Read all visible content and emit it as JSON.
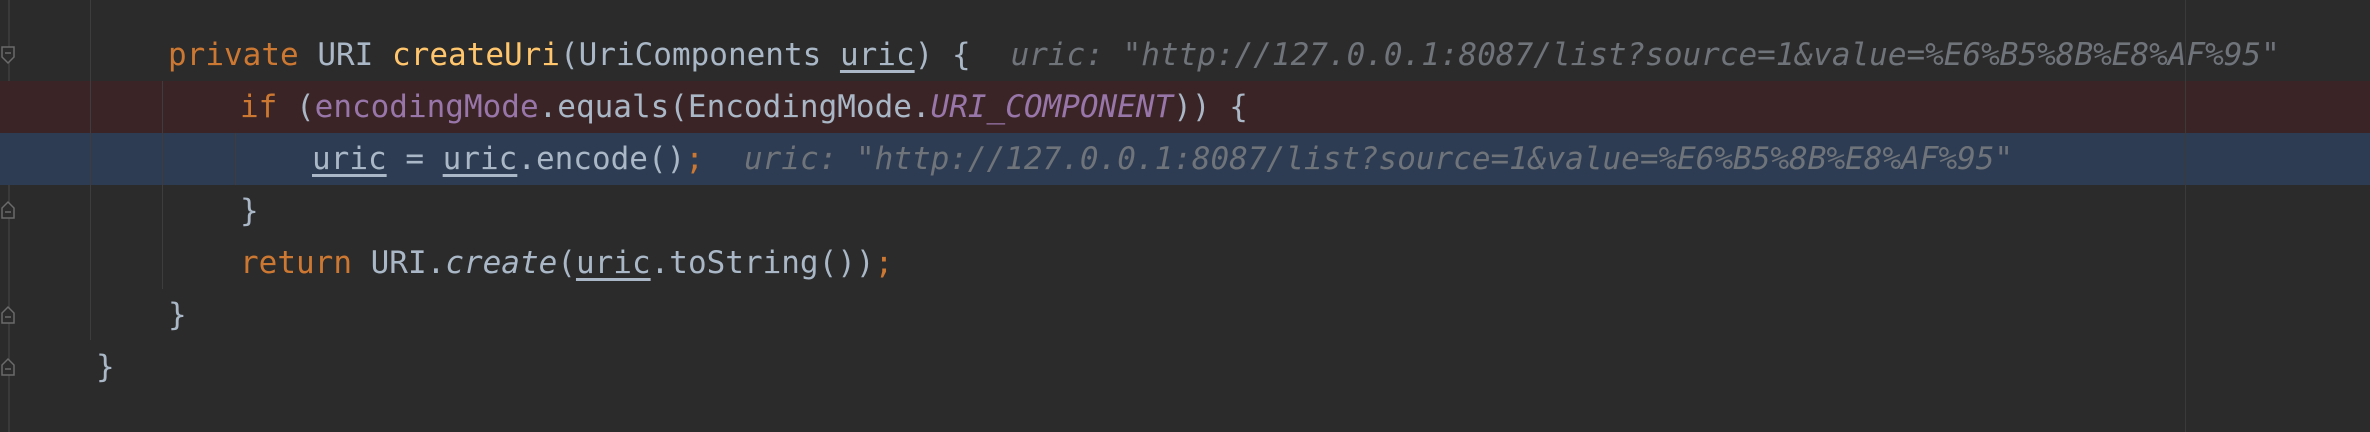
{
  "editor": {
    "lines": [
      {
        "tokens": {
          "private": "private",
          "uri_type": "URI",
          "method": "createUri",
          "paren_open": "(",
          "param_type": "UriComponents",
          "param": "uric",
          "sig_close": ") {"
        },
        "hint": "uric: \"http://127.0.0.1:8087/list?source=1&value=%E6%B5%8B%E8%AF%95\""
      },
      {
        "tokens": {
          "if": "if",
          "paren": " (",
          "field": "encodingMode",
          "equals": ".equals(EncodingMode.",
          "const": "URI_COMPONENT",
          "close": ")) {"
        }
      },
      {
        "tokens": {
          "var": "uric",
          "assign": " = ",
          "var2": "uric",
          "call": ".encode()",
          "semi": ";"
        },
        "hint": "uric: \"http://127.0.0.1:8087/list?source=1&value=%E6%B5%8B%E8%AF%95\""
      },
      {
        "tokens": {
          "brace": "}"
        }
      },
      {
        "tokens": {
          "return": "return",
          "uri": " URI.",
          "create": "create",
          "open": "(",
          "var": "uric",
          "tostring": ".toString())",
          "semi": ";"
        }
      },
      {
        "tokens": {
          "brace": "}"
        }
      },
      {
        "tokens": {
          "brace": "}"
        }
      }
    ]
  },
  "colors": {
    "background": "#2b2b2b",
    "keyword": "#cc7832",
    "method": "#ffc66d",
    "field": "#9876aa",
    "text": "#a9b7c6",
    "hint": "#6f737a",
    "error_line": "#3b2425",
    "current_line": "#2d3c52"
  }
}
